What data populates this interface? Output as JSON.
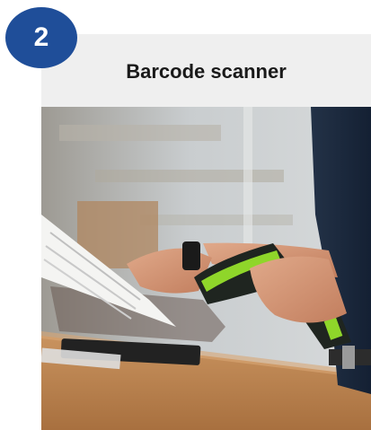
{
  "step": {
    "number": "2"
  },
  "card": {
    "title": "Barcode scanner",
    "image_subject": "barcode-scanner-photo"
  },
  "colors": {
    "badge": "#1f4e99",
    "card_background": "#efefef",
    "scanner_accent": "#8fd62a"
  }
}
